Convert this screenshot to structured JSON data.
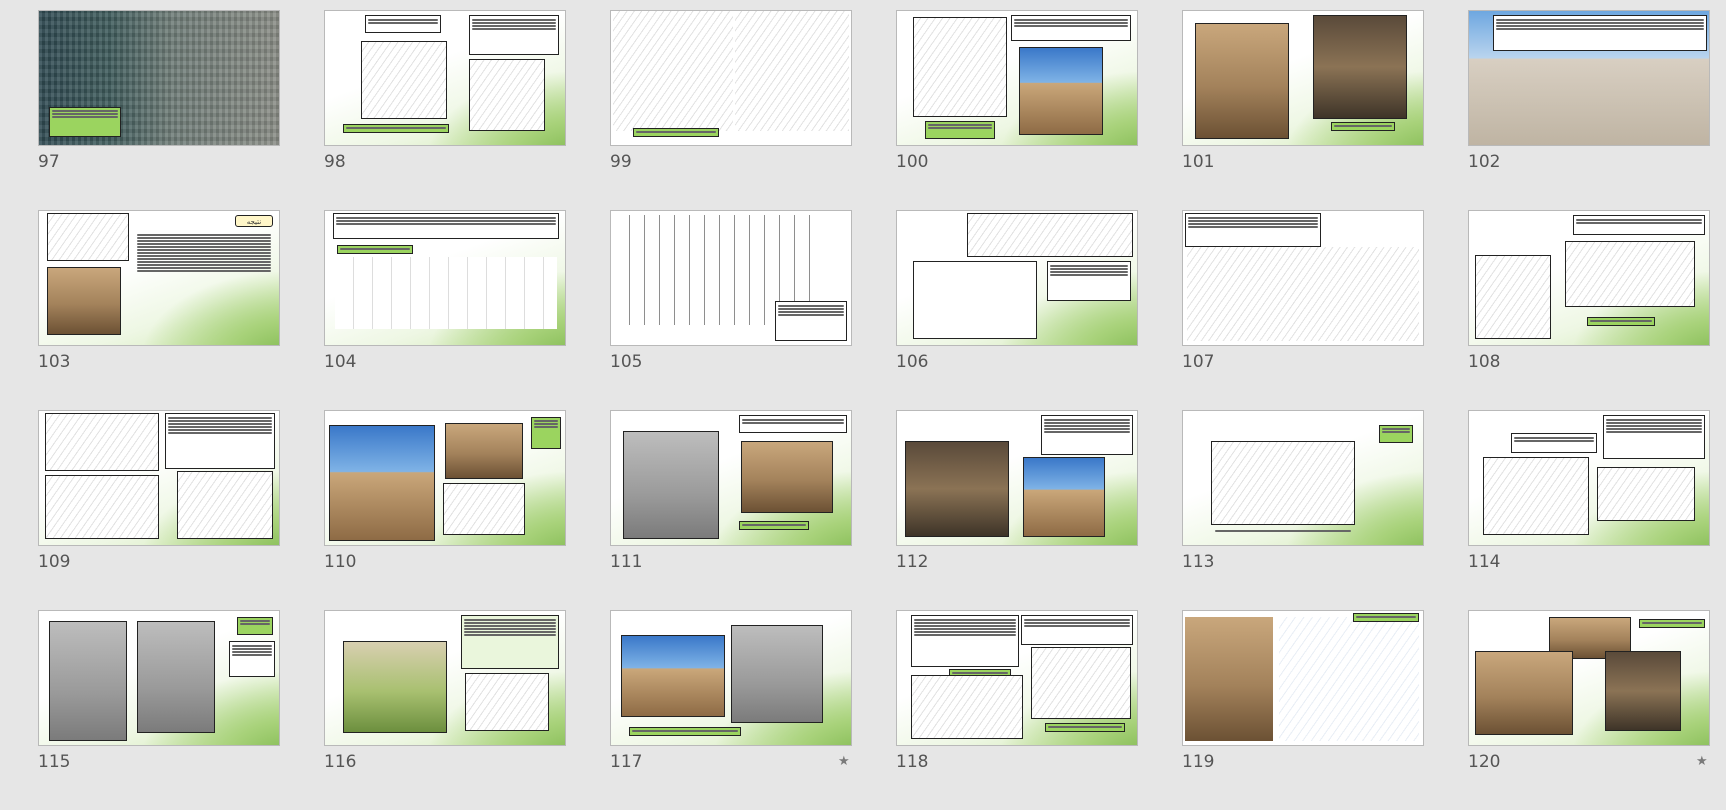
{
  "slides": [
    {
      "number": "97",
      "starred": false
    },
    {
      "number": "98",
      "starred": false
    },
    {
      "number": "99",
      "starred": false
    },
    {
      "number": "100",
      "starred": false
    },
    {
      "number": "101",
      "starred": false
    },
    {
      "number": "102",
      "starred": false
    },
    {
      "number": "103",
      "starred": false
    },
    {
      "number": "104",
      "starred": false
    },
    {
      "number": "105",
      "starred": false
    },
    {
      "number": "106",
      "starred": false
    },
    {
      "number": "107",
      "starred": false
    },
    {
      "number": "108",
      "starred": false
    },
    {
      "number": "109",
      "starred": false
    },
    {
      "number": "110",
      "starred": false
    },
    {
      "number": "111",
      "starred": false
    },
    {
      "number": "112",
      "starred": false
    },
    {
      "number": "113",
      "starred": false
    },
    {
      "number": "114",
      "starred": false
    },
    {
      "number": "115",
      "starred": false
    },
    {
      "number": "116",
      "starred": false
    },
    {
      "number": "117",
      "starred": true
    },
    {
      "number": "118",
      "starred": false
    },
    {
      "number": "119",
      "starred": false
    },
    {
      "number": "120",
      "starred": true
    }
  ],
  "slide_103_label": "نتیجه",
  "star_glyph": "★",
  "colors": {
    "background": "#e6e6e6",
    "label_green": "#9bd45f",
    "slide_number": "#555555"
  }
}
